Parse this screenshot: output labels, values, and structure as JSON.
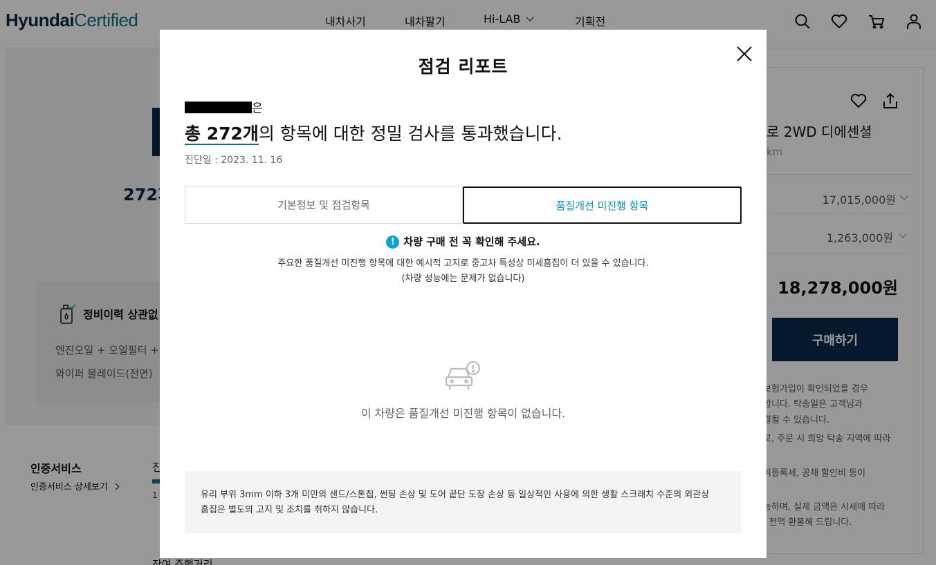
{
  "header": {
    "logo_part1": "Hyundai",
    "logo_part2": "Certified",
    "nav": [
      "내차사기",
      "내차팔기",
      "Hi-LAB",
      "기획전"
    ],
    "icons": [
      "search-icon",
      "heart-icon",
      "cart-icon",
      "user-icon"
    ]
  },
  "left_panel": {
    "count_partial": "272개",
    "card_title": "정비이력 상관없",
    "card_line1": "엔진오일 + 오일필터 + (",
    "card_line2": "와이퍼 블레이드(전면)",
    "cert_title": "인증서비스",
    "cert_link": "인증서비스 상세보기",
    "tab_partial": "진",
    "tab_num": "1",
    "bottom_partial": "잔여 주행거리"
  },
  "right_panel": {
    "title_partial": "로 2WD 디에센셜",
    "km_partial": "km",
    "price1": "17,015,000원",
    "price2": "1,263,000원",
    "total": "18,278,000원",
    "buy_button": "구매하기",
    "notes": [
      "보험가입이 확인되었을 경우",
      "합니다. 탁송일은 고객님과",
      "결될 수 있습니다.",
      "로, 주문 시 희망 탁송 지역에 따라",
      "취등록세, 공채 할인비 등이",
      "능하며, 실제 금액은 시세에 따라",
      "· 전액 환불해 드립니다."
    ]
  },
  "modal": {
    "title": "점검 리포트",
    "plate_suffix": "은",
    "headline_bold": "총 272개",
    "headline_rest": "의 항목에 대한 정밀 검사를 통과했습니다.",
    "date": "진단일 : 2023. 11. 16",
    "tabs": [
      {
        "label": "기본정보 및 점검항목",
        "active": false
      },
      {
        "label": "품질개선 미진행 항목",
        "active": true
      }
    ],
    "alert_icon": "!",
    "alert_text": "차량 구매 전 꼭 확인해 주세요.",
    "desc1": "주요한 품질개선 미진행 항목에 대한 예시적 고지로 중고차 특성상 미세흠집이 더 있을 수 있습니다.",
    "desc2": "(차량 성능에는 문제가 없습니다)",
    "empty_text": "이 차량은 품질개선 미진행 항목이 없습니다.",
    "notice_line1": "유리 부위 3mm 이하 3개 미만의 샌드/스톤칩, 썬팅 손상 및 도어 끝단 도장 손상 등 일상적인 사용에 의한 생활 스크래치 수준의 외관상",
    "notice_line2": "흠집은 별도의 고지 및 조치를 취하지 않습니다."
  },
  "colors": {
    "brand_navy": "#0b2a4a",
    "accent_teal": "#0a8fb5",
    "alert_blue": "#0aa3d1"
  }
}
